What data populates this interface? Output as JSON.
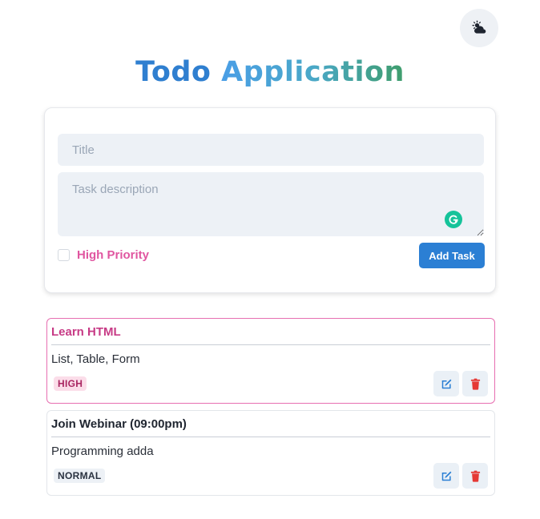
{
  "header": {
    "title_part1": "Todo",
    "title_part2": "Application",
    "theme_icon": "cloud-sun-icon"
  },
  "form": {
    "title_placeholder": "Title",
    "description_placeholder": "Task description",
    "title_value": "",
    "description_value": "",
    "priority_label": "High Priority",
    "priority_checked": false,
    "add_button_label": "Add Task",
    "grammarly_icon": "grammarly-icon"
  },
  "tasks": [
    {
      "title": "Learn HTML",
      "description": "List, Table, Form",
      "priority": "HIGH",
      "edit_icon": "edit-icon",
      "delete_icon": "trash-icon"
    },
    {
      "title": "Join Webinar (09:00pm)",
      "description": "Programming adda",
      "priority": "NORMAL",
      "edit_icon": "edit-icon",
      "delete_icon": "trash-icon"
    }
  ],
  "colors": {
    "accent_blue": "#2b7fd4",
    "priority_pink": "#e056a0",
    "danger_red": "#e53935",
    "input_bg": "#edf1f6"
  }
}
